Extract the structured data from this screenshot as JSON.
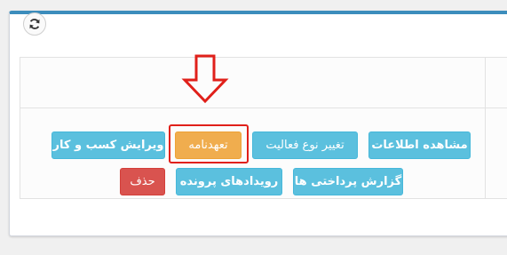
{
  "toolbar": {
    "refresh_icon": "refresh-icon"
  },
  "annotation": {
    "arrow_icon": "arrow-down-icon",
    "color": "#e0201a"
  },
  "actions": {
    "view_info": "مشاهده اطلاعات",
    "change_activity_type": "تغییر نوع فعالیت",
    "commitment": "تعهدنامه",
    "edit_business": "ویرایش کسب و کار",
    "payment_report": "گزارش پرداختی ها",
    "case_events": "رویدادهای پرونده",
    "delete": "حذف"
  },
  "colors": {
    "info": "#5bc0de",
    "warning": "#f0ad4e",
    "danger": "#d9534f",
    "panel_header": "#3c8dbc"
  }
}
